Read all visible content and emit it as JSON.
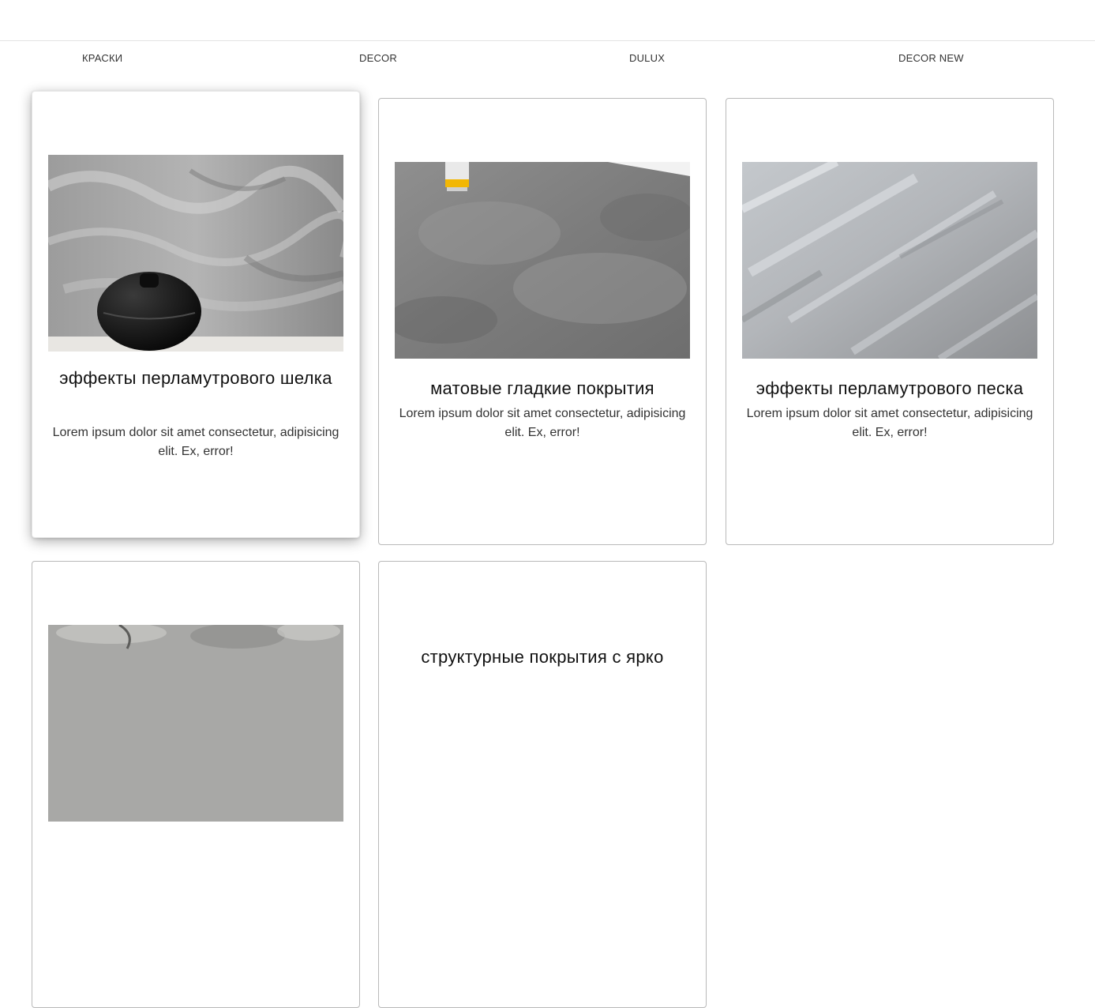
{
  "nav": {
    "items": [
      "КРАСКИ",
      "DECOR",
      "DULUX",
      "DECOR NEW"
    ]
  },
  "cards": [
    {
      "title": "эффекты перламутрового шелка",
      "text": "Lorem ipsum dolor sit amet consectetur, adipisicing elit. Ex, error!",
      "image": "gray-silk-wall-with-black-vase"
    },
    {
      "title": "матовые гладкие покрытия",
      "text": "Lorem ipsum dolor sit amet consectetur, adipisicing elit. Ex, error!",
      "image": "matte-gray-concrete-wall"
    },
    {
      "title": "эффекты перламутрового песка",
      "text": "Lorem ipsum dolor sit amet consectetur, adipisicing elit. Ex, error!",
      "image": "silver-pearl-sand-texture"
    },
    {
      "title": "",
      "text": "",
      "image": "textured-plaster-wall"
    },
    {
      "title": "структурные покрытия с ярко",
      "text": "",
      "image": ""
    }
  ],
  "colors": {
    "card_border": "#b9b9b9",
    "title": "#111111",
    "text": "#333333"
  }
}
